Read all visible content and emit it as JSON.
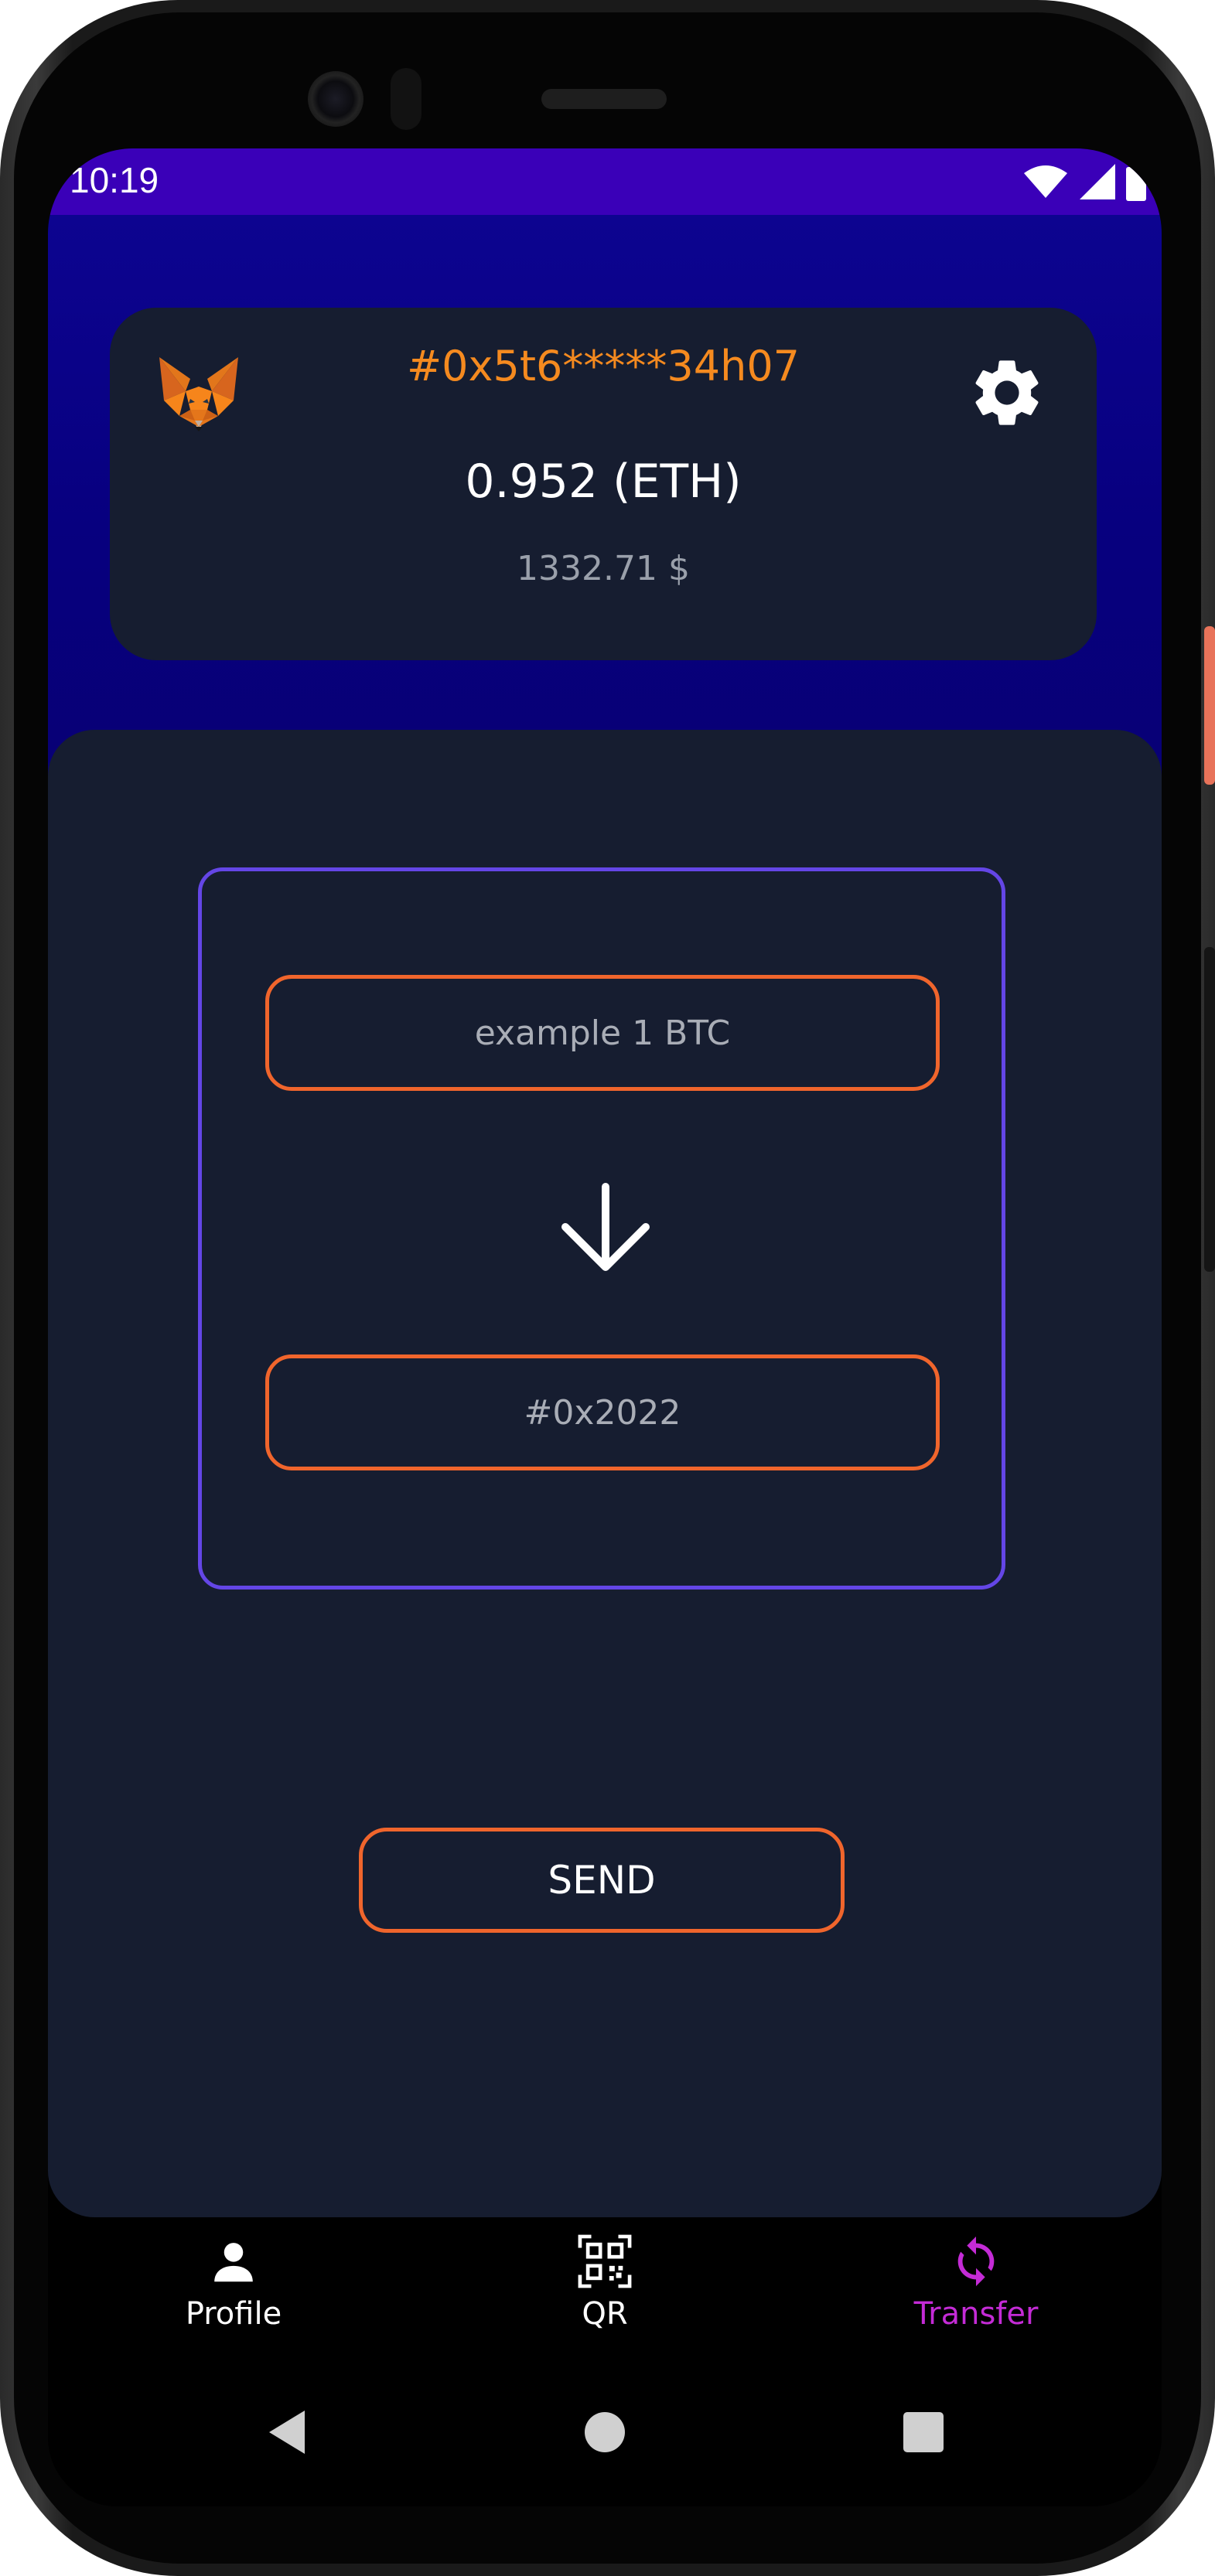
{
  "status_bar": {
    "time": "10:19",
    "icons": [
      "wifi-icon",
      "signal-icon",
      "battery-icon"
    ]
  },
  "wallet": {
    "logo_icon": "metamask-fox-icon",
    "address": "#0x5t6*****34h07",
    "balance": "0.952 (ETH)",
    "fiat": "1332.71 $",
    "settings_icon": "gear-icon"
  },
  "transfer": {
    "amount_placeholder": "example 1 BTC",
    "recipient_placeholder": "#0x2022",
    "arrow_icon": "arrow-down-icon",
    "send_label": "SEND"
  },
  "bottom_nav": {
    "items": [
      {
        "label": "Profile",
        "icon": "person-icon",
        "active": false
      },
      {
        "label": "QR",
        "icon": "qr-code-icon",
        "active": false
      },
      {
        "label": "Transfer",
        "icon": "sync-icon",
        "active": true
      }
    ]
  },
  "system_nav": [
    "back-icon",
    "home-icon",
    "recents-icon"
  ],
  "colors": {
    "accent_orange": "#f0652c",
    "address_orange": "#f58a1f",
    "form_border_purple": "#6446e6",
    "active_nav": "#c42bd6",
    "card_bg": "#161d30",
    "hero_bg": "#07007f",
    "status_bar_bg": "#3a00b8"
  }
}
